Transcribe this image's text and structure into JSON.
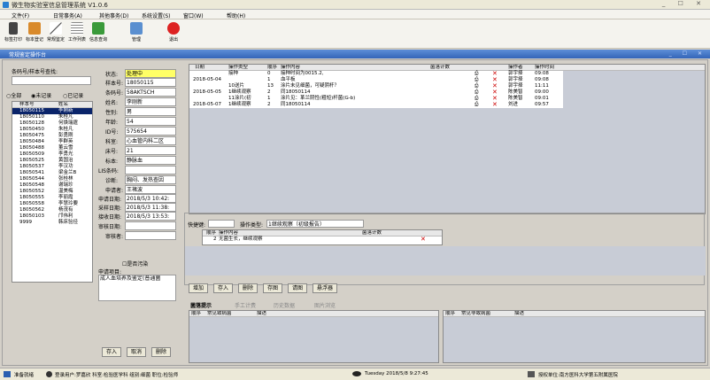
{
  "window": {
    "title": "微生物实验室信息管理系统 V1.0.6",
    "controls": "_ ☐ ✕"
  },
  "menu": [
    "文件(F)",
    "日常事务(A)",
    "其他事务(D)",
    "系统设置(S)",
    "窗口(W)",
    "帮助(H)"
  ],
  "toolbar": [
    "标签打印",
    "标本登记",
    "常规鉴定",
    "工作列表",
    "信息查询",
    "管理",
    "退出"
  ],
  "subwindow": {
    "title": "常规鉴定操作台",
    "controls": "_ ☐ ✕"
  },
  "left": {
    "search_label": "条码号/样本号查找:",
    "radios": [
      "全部",
      "未记录",
      "已记录"
    ],
    "list_headers": [
      "样本号",
      "姓名"
    ],
    "list_rows": [
      [
        "18050115",
        "李刚新"
      ],
      [
        "18050110",
        "朱桂凡"
      ],
      [
        "18050128",
        "何焕瑞霆"
      ],
      [
        "18050450",
        "朱桂凡"
      ],
      [
        "18050475",
        "彭勇刚"
      ],
      [
        "18050484",
        "李群英"
      ],
      [
        "18050488",
        "董云雪"
      ],
      [
        "18050509",
        "李勇光"
      ],
      [
        "18050525",
        "黄国治"
      ],
      [
        "18050537",
        "李汉功"
      ],
      [
        "18050541",
        "梁金兰B"
      ],
      [
        "18050544",
        "张桂林"
      ],
      [
        "18050548",
        "谢瑞珍"
      ],
      [
        "18050552",
        "温美梅"
      ],
      [
        "18050555",
        "李丽霞"
      ],
      [
        "18050558",
        "李慧玲要"
      ],
      [
        "18050562",
        "杨茂有"
      ],
      [
        "18050103",
        "邝伟利"
      ],
      [
        "9999",
        "韩床验径"
      ]
    ]
  },
  "form": {
    "fields": [
      {
        "label": "状态:",
        "value": "处理中"
      },
      {
        "label": "样本号:",
        "value": "18050115"
      },
      {
        "label": "条码号:",
        "value": "58AKTSCH"
      },
      {
        "label": "姓名:",
        "value": "李刚新"
      },
      {
        "label": "性别:",
        "value": "男"
      },
      {
        "label": "年龄:",
        "value": "54"
      },
      {
        "label": "ID号:",
        "value": "575654"
      },
      {
        "label": "科室:",
        "value": "心血管内科二区"
      },
      {
        "label": "床号:",
        "value": "21"
      },
      {
        "label": "标本:",
        "value": "静脉血"
      },
      {
        "label": "LIS条码:",
        "value": ""
      },
      {
        "label": "诊断:",
        "value": "胸闷、发热查因"
      },
      {
        "label": "申请者:",
        "value": "王褚波"
      },
      {
        "label": "申请日期:",
        "value": "2018/5/3 10:42:"
      },
      {
        "label": "采样日期:",
        "value": "2018/5/3 11:38:"
      },
      {
        "label": "接收日期:",
        "value": "2018/5/3 13:53:"
      },
      {
        "label": "审核日期:",
        "value": ""
      },
      {
        "label": "审核者:",
        "value": ""
      }
    ],
    "contaminated": "是否污染",
    "items_label": "申请项目:",
    "items_value": "成人血培养及鉴定(普通菌",
    "buttons": [
      "存入",
      "取消",
      "删除"
    ]
  },
  "oplog": {
    "headers": [
      "日期",
      "操作类型",
      "顺序",
      "操作内容",
      "菌落计数",
      "",
      "",
      "操作者",
      "操作时间"
    ],
    "rows": [
      {
        "date": "",
        "type": "接种",
        "seq": "0",
        "content": "接种时间为0015.2,",
        "op": "郭宇择",
        "time": "09:08"
      },
      {
        "date": "2018-05-04",
        "type": "",
        "seq": "1",
        "content": "血平板",
        "op": "郭宇择",
        "time": "09:08"
      },
      {
        "date": "",
        "type": "10送片",
        "seq": "13",
        "content": "涂片未见细菌，可疑阴杆？",
        "op": "郭宇择",
        "time": "11:11"
      },
      {
        "date": "2018-05-05",
        "type": "1继续观察",
        "seq": "2",
        "content": "同18050114",
        "op": "陈美智",
        "time": "09:00"
      },
      {
        "date": "",
        "type": "11涂片(初",
        "seq": "1",
        "content": "涂片见：革兰阴性(粗短)杆菌(G-b)",
        "op": "陈美智",
        "time": "09:01"
      },
      {
        "date": "2018-05-07",
        "type": "1继续观察",
        "seq": "2",
        "content": "同18050114",
        "op": "刘进",
        "time": "09:57"
      }
    ]
  },
  "quick": {
    "key_label": "快捷键:",
    "type_label": "操作类型:",
    "type_value": "1继续观察（初级报告）",
    "headers": [
      "顺序",
      "操作内容",
      "菌落计数"
    ],
    "rows": [
      {
        "seq": "2",
        "content": "无菌生长，继续观察"
      }
    ],
    "buttons": [
      "增加",
      "存入",
      "删除",
      "存图",
      "请图",
      "悬浮器"
    ]
  },
  "bottom": {
    "tabs": [
      "菌落提示",
      "手工计费",
      "历史数据",
      "图片浏览"
    ],
    "left_headers": [
      "顺序",
      "常见致病菌",
      "描述"
    ],
    "right_headers": [
      "顺序",
      "常见非致病菌",
      "描述"
    ]
  },
  "status": {
    "ready": "准备就绪",
    "user": "登录用户:罗嘉欣  科室:检验医学科  组别:细菌  职位:检验师",
    "datetime": "Tuesday 2018/5/8 9:27:45",
    "org": "授权单位:南方医科大学第五附属医院"
  },
  "colors": {
    "status_highlight": "#ffff66",
    "selection": "#0a246a",
    "accent": "#3465b8"
  }
}
